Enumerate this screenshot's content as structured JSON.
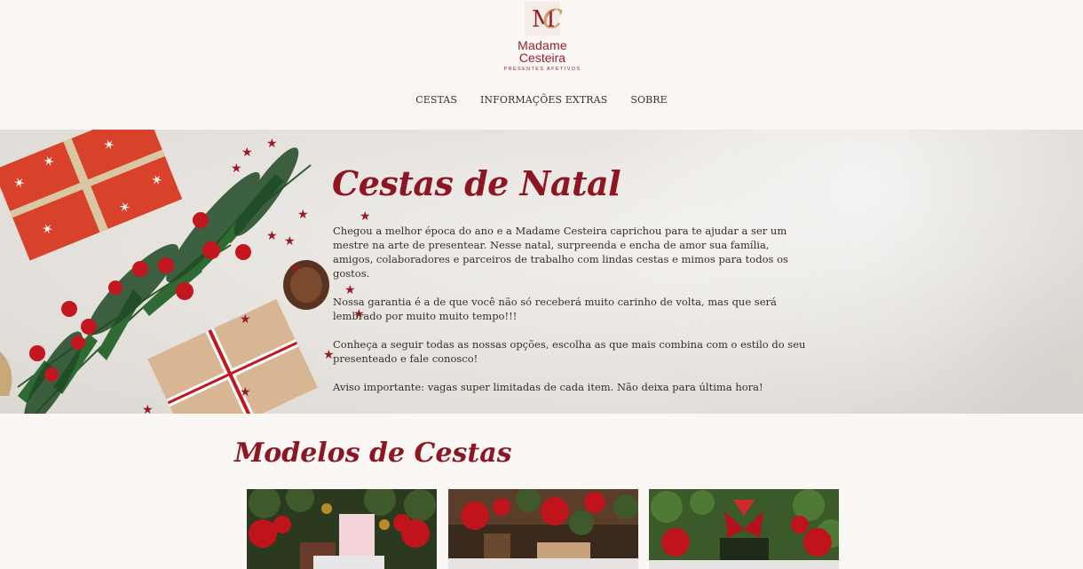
{
  "brand": {
    "name_line1": "Madame",
    "name_line2": "Cesteira",
    "tagline": "PRESENTES AFETIVOS",
    "monogram": "MC",
    "color": "#9b1e2a"
  },
  "nav": {
    "items": [
      {
        "label": "CESTAS"
      },
      {
        "label": "INFORMAÇÕES EXTRAS"
      },
      {
        "label": "SOBRE"
      }
    ]
  },
  "hero": {
    "title": "Cestas de Natal",
    "paragraphs": [
      "Chegou a melhor época do ano e a Madame Cesteira caprichou para te ajudar a ser um mestre na arte de presentear. Nesse natal, surpreenda e encha de amor sua família, amigos, colaboradores e parceiros de trabalho com lindas cestas e mimos para todos os gostos.",
      "Nossa garantia é a de que você não só receberá muito carinho de volta, mas que será lembrado por muito muito tempo!!!",
      "Conheça a seguir todas as nossas opções, escolha as que mais combina com o estilo do seu presenteado e fale conosco!",
      "Aviso importante: vagas super limitadas de cada item. Não deixa para última hora!"
    ],
    "image": "christmas-gifts-pine-berries"
  },
  "models": {
    "title": "Modelos de Cestas",
    "cards": [
      {
        "image": "christmas-basket-1"
      },
      {
        "image": "christmas-basket-2"
      },
      {
        "image": "christmas-basket-3"
      }
    ]
  },
  "colors": {
    "accent": "#8e1522",
    "background": "#faf7f4",
    "text": "#3a2c26"
  }
}
